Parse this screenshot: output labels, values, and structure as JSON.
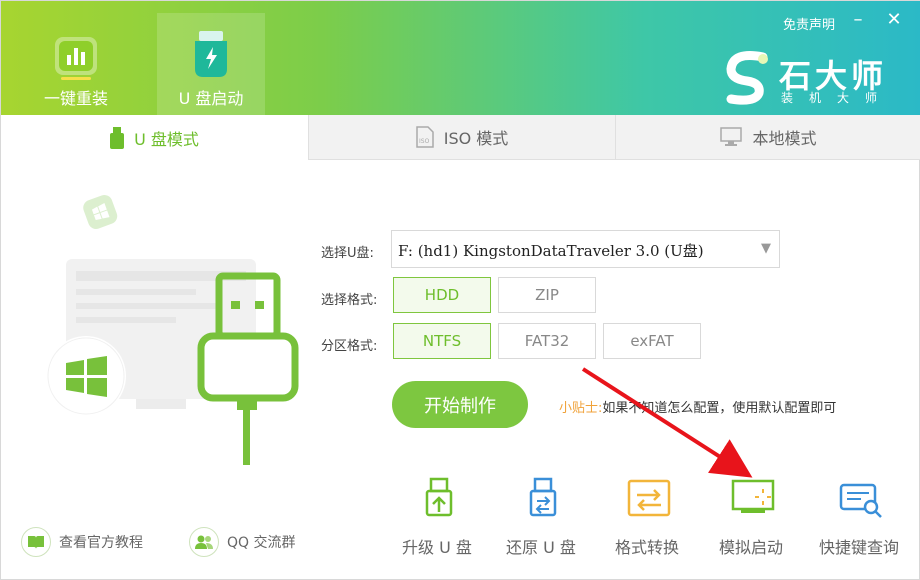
{
  "header": {
    "nav": [
      {
        "label": "一键重装",
        "icon": "bar-chart-icon",
        "active": false
      },
      {
        "label": "U 盘启动",
        "icon": "usb-bolt-icon",
        "active": true
      }
    ],
    "disclaimer": "免责声明",
    "brand": {
      "name": "石大师",
      "sub": "装机大师"
    },
    "colors": {
      "gradient_start": "#a7d530",
      "gradient_end": "#2bb9c7",
      "accent": "#7dc740"
    }
  },
  "tabs": [
    {
      "label": "U 盘模式",
      "icon": "usb-drive-icon",
      "active": true
    },
    {
      "label": "ISO 模式",
      "icon": "iso-file-icon",
      "active": false
    },
    {
      "label": "本地模式",
      "icon": "monitor-icon",
      "active": false
    }
  ],
  "form": {
    "usb_label": "选择U盘:",
    "usb_value": "F: (hd1) KingstonDataTraveler 3.0 (U盘)",
    "format_label": "选择格式:",
    "formats": [
      {
        "label": "HDD",
        "selected": true
      },
      {
        "label": "ZIP",
        "selected": false
      }
    ],
    "partition_label": "分区格式:",
    "partitions": [
      {
        "label": "NTFS",
        "selected": true
      },
      {
        "label": "FAT32",
        "selected": false
      },
      {
        "label": "exFAT",
        "selected": false
      }
    ],
    "start_button": "开始制作",
    "tip_label": "小贴士:",
    "tip_text": "如果不知道怎么配置，使用默认配置即可"
  },
  "tools": [
    {
      "label": "升级 U 盘",
      "icon": "usb-upgrade-icon"
    },
    {
      "label": "还原 U 盘",
      "icon": "usb-restore-icon"
    },
    {
      "label": "格式转换",
      "icon": "format-convert-icon"
    },
    {
      "label": "模拟启动",
      "icon": "simulate-boot-icon"
    },
    {
      "label": "快捷键查询",
      "icon": "keyboard-search-icon"
    }
  ],
  "footer": {
    "tutorial": "查看官方教程",
    "qq": "QQ 交流群"
  }
}
